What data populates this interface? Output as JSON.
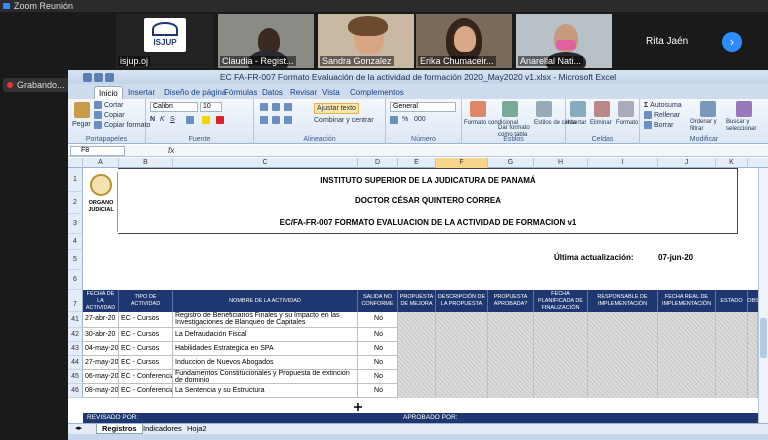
{
  "zoom": {
    "window_title": "Zoom Reunión",
    "recording_label": "Grabando...",
    "participants": [
      {
        "name": "isjup.oj"
      },
      {
        "name": "Claudia - Regist..."
      },
      {
        "name": "Sandra Gonzalez"
      },
      {
        "name": "Erika Chumaceir..."
      },
      {
        "name": "Anarellal Nati..."
      },
      {
        "name": "Rita Jaén"
      }
    ],
    "logo_text": "ISJUP"
  },
  "excel": {
    "title": "EC FA-FR-007 Formato Evaluación de la actividad de formación 2020_May2020 v1.xlsx - Microsoft Excel",
    "tabs": [
      "Inicio",
      "Insertar",
      "Diseño de página",
      "Fórmulas",
      "Datos",
      "Revisar",
      "Vista",
      "Complementos"
    ],
    "ribbon": {
      "clipboard": {
        "paste": "Pegar",
        "cut": "Cortar",
        "copy": "Copiar",
        "format_painter": "Copiar formato",
        "label": "Portapapeles"
      },
      "font": {
        "name": "Calibri",
        "size": "10",
        "label": "Fuente"
      },
      "alignment": {
        "wrap": "Ajustar texto",
        "merge": "Combinar y centrar",
        "label": "Alineación"
      },
      "number": {
        "format": "General",
        "label": "Número"
      },
      "styles": {
        "conditional": "Formato condicional",
        "table": "Dar formato como tabla",
        "cell": "Estilos de celda",
        "label": "Estilos"
      },
      "cells": {
        "insert": "Insertar",
        "delete": "Eliminar",
        "format": "Formato",
        "label": "Celdas"
      },
      "editing": {
        "autosum": "Autosuma",
        "fill": "Rellenar",
        "clear": "Borrar",
        "sort": "Ordenar y filtrar",
        "find": "Buscar y seleccionar",
        "label": "Modificar"
      }
    },
    "name_box": "F8",
    "fx": "fx",
    "columns": [
      "A",
      "B",
      "C",
      "D",
      "E",
      "F",
      "G",
      "H",
      "I",
      "J",
      "K"
    ],
    "header": {
      "institute": "INSTITUTO SUPERIOR DE LA JUDICATURA DE PANAMÁ",
      "director": "DOCTOR CÉSAR QUINTERO CORREA",
      "form_title": "EC/FA-FR-007 FORMATO EVALUACION DE LA ACTIVIDAD DE FORMACION v1",
      "last_update_label": "Última actualización:",
      "last_update_value": "07-jun-20",
      "logo_line1": "ORGANO",
      "logo_line2": "JUDICIAL"
    },
    "table_headers": [
      "FECHA DE LA ACTIVIDAD",
      "TIPO DE ACTIVIDAD",
      "NOMBRE DE LA ACTIVIDAD",
      "SALIDA NO CONFORME",
      "PROPUESTA DE MEJORA",
      "DESCRIPCIÓN DE LA PROPUESTA",
      "PROPUESTA APROBADA?",
      "FECHA PLANIFICADA DE FINALIZACIÓN",
      "RESPONSABLE DE IMPLEMENTACIÓN",
      "FECHA REAL DE IMPLEMENTACIÓN",
      "ESTADO",
      "OBS"
    ],
    "rows": [
      {
        "num": "41",
        "date": "27-abr-20",
        "type": "EC - Cursos",
        "name": "Registro de Beneficiarios Finales y su Impacto en las Investigaciones de Blanqueo de Capitales",
        "nc": "No"
      },
      {
        "num": "42",
        "date": "30-abr-20",
        "type": "EC - Cursos",
        "name": "La Defraudación Fiscal",
        "nc": "No"
      },
      {
        "num": "43",
        "date": "04-may-20",
        "type": "EC - Cursos",
        "name": "Habilidades Estrategica en SPA",
        "nc": "No"
      },
      {
        "num": "44",
        "date": "27-may-20",
        "type": "EC - Cursos",
        "name": "Induccion de Nuevos Abogados",
        "nc": "No"
      },
      {
        "num": "45",
        "date": "06-may-20",
        "type": "EC - Conferencias",
        "name": "Fundamentos Constitucionales y Propuesta de extincion de dominio",
        "nc": "No"
      },
      {
        "num": "46",
        "date": "08-may-20",
        "type": "EC - Conferencias",
        "name": "La Sentencia y su Estructura",
        "nc": "No"
      }
    ],
    "footer": {
      "revised": "REVISADO POR:",
      "approved": "APROBADO POR:"
    },
    "sheet_tabs": [
      "Registros",
      "Indicadores",
      "Hoja2"
    ],
    "row_labels": [
      "1",
      "2",
      "3",
      "4",
      "5",
      "6",
      "7"
    ]
  }
}
